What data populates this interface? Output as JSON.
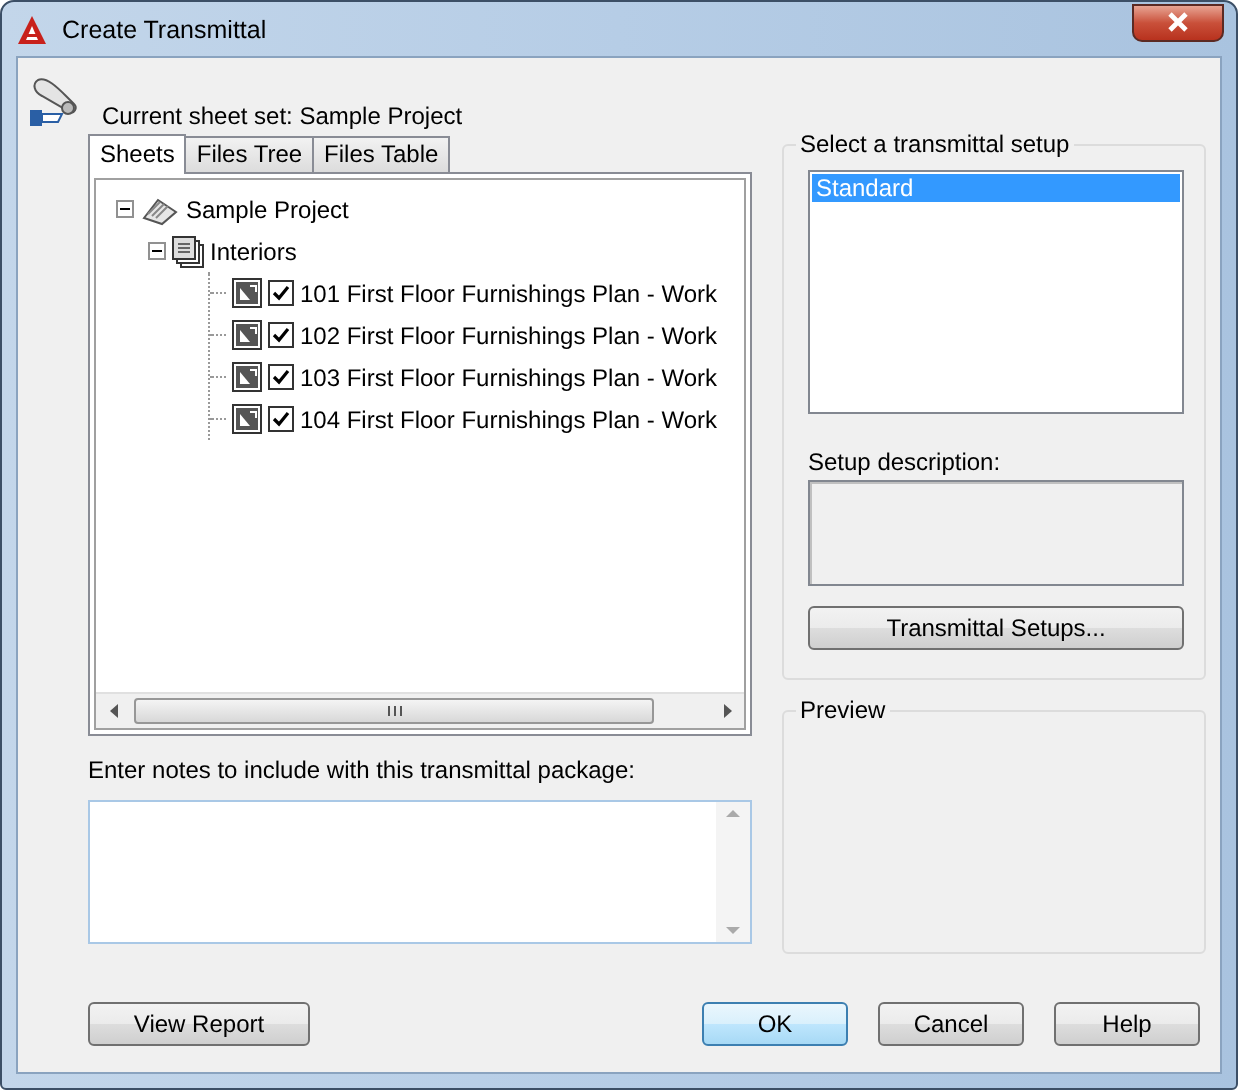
{
  "window": {
    "title": "Create Transmittal"
  },
  "header": {
    "text": "Current sheet set: Sample Project"
  },
  "tabs": [
    {
      "label": "Sheets",
      "selected": true
    },
    {
      "label": "Files Tree",
      "selected": false
    },
    {
      "label": "Files Table",
      "selected": false
    }
  ],
  "tree": {
    "label": "Sample Project",
    "kind": "sheetset",
    "expanded": true,
    "children": [
      {
        "label": "Interiors",
        "kind": "subset",
        "expanded": true,
        "children": [
          {
            "label": "101 First Floor Furnishings Plan - Work",
            "kind": "sheet",
            "checked": true
          },
          {
            "label": "102 First Floor Furnishings Plan - Work",
            "kind": "sheet",
            "checked": true
          },
          {
            "label": "103 First Floor Furnishings Plan - Work",
            "kind": "sheet",
            "checked": true
          },
          {
            "label": "104 First Floor Furnishings Plan - Work",
            "kind": "sheet",
            "checked": true
          }
        ]
      }
    ]
  },
  "notes": {
    "label": "Enter notes to include with this transmittal package:"
  },
  "setup": {
    "title": "Select a transmittal setup",
    "items": [
      {
        "label": "Standard",
        "selected": true
      }
    ],
    "description_label": "Setup description:",
    "button": "Transmittal Setups..."
  },
  "preview": {
    "title": "Preview"
  },
  "buttons": [
    {
      "label": "View Report",
      "kind": "left",
      "default": false
    },
    {
      "label": "OK",
      "kind": "right",
      "default": true
    },
    {
      "label": "Cancel",
      "kind": "right",
      "default": false
    },
    {
      "label": "Help",
      "kind": "right",
      "default": false
    }
  ]
}
